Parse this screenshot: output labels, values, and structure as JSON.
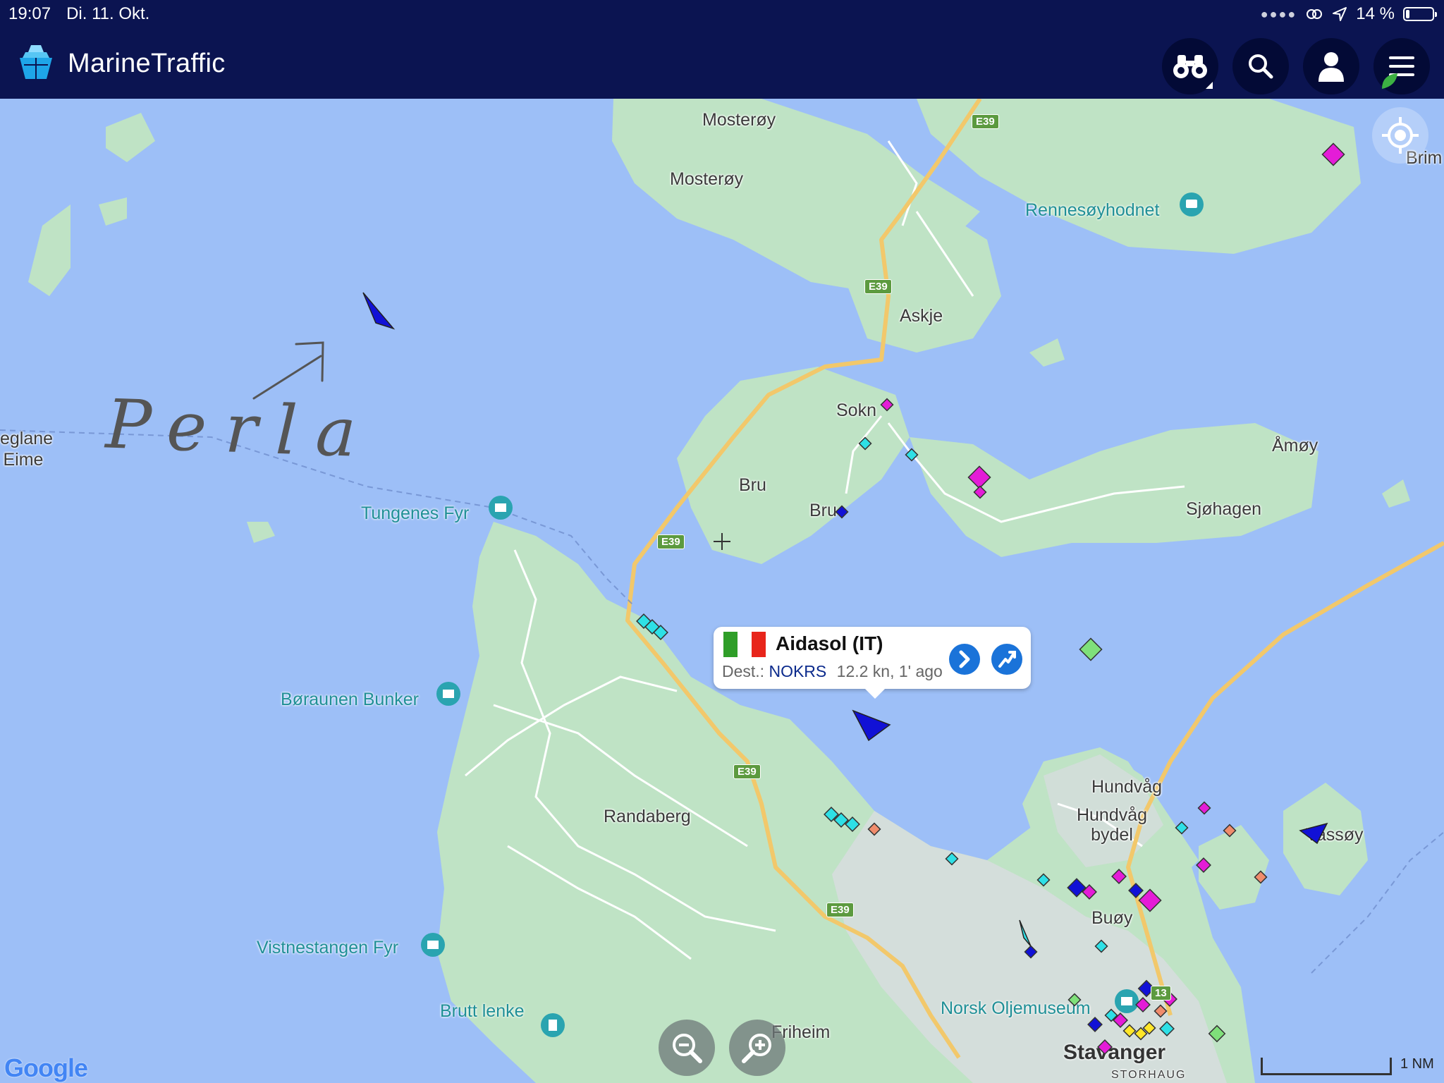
{
  "status_bar": {
    "time": "19:07",
    "date": "Di. 11. Okt.",
    "battery": "14 %",
    "battery_level": 0.14
  },
  "header": {
    "app_name": "MarineTraffic",
    "buttons": [
      "binoculars-icon",
      "search-icon",
      "user-icon",
      "menu-icon"
    ]
  },
  "map": {
    "labels": {
      "mosteroy_1": "Mosterøy",
      "mosteroy_2": "Mosterøy",
      "askje": "Askje",
      "sokn": "Sokn",
      "bru": "Bru",
      "bru_2": "Bru",
      "amoy": "Åmøy",
      "sjohagen": "Sjøhagen",
      "randaberg": "Randaberg",
      "hundvag": "Hundvåg",
      "hundvag_bydel": "Hundvåg bydel",
      "buoy": "Buøy",
      "vassoy": "Vassøy",
      "friheim": "Friheim",
      "brim": "Brim",
      "eglane": "eglane",
      "eime": "j Eime",
      "storhaug": "STORHAUG"
    },
    "cities": {
      "stavanger": "Stavanger"
    },
    "pois": {
      "rennesoyhodnet": "Rennesøyhodnet",
      "tungenes": "Tungenes Fyr",
      "boraunen": "Børaunen Bunker",
      "vistnestangen": "Vistnestangen Fyr",
      "brutt_lenke": "Brutt lenke",
      "oljemuseum": "Norsk Oljemuseum"
    },
    "road_shields": [
      "E39",
      "E39",
      "E39",
      "E39",
      "E39",
      "13"
    ],
    "handwritten_annotation": "Perla",
    "attribution": "Google",
    "scale": "1 NM"
  },
  "vessel_popup": {
    "name": "Aidasol (IT)",
    "dest_label": "Dest.:",
    "dest_code": "NOKRS",
    "speed_time": "12.2 kn, 1' ago",
    "flag_colors": [
      "#2f9e28",
      "#ffffff",
      "#e8251b"
    ]
  },
  "colors": {
    "header_bg": "#0b1451",
    "sea": "#9dbff7",
    "land": "#bfe3c5",
    "road": "#f2c86b",
    "vessel_passenger": "#1111d6",
    "vessel_tug": "#2ee0e6",
    "vessel_pleasure": "#e41cd7",
    "vessel_cargo": "#7fe07a",
    "vessel_tanker": "#f08c6c"
  }
}
